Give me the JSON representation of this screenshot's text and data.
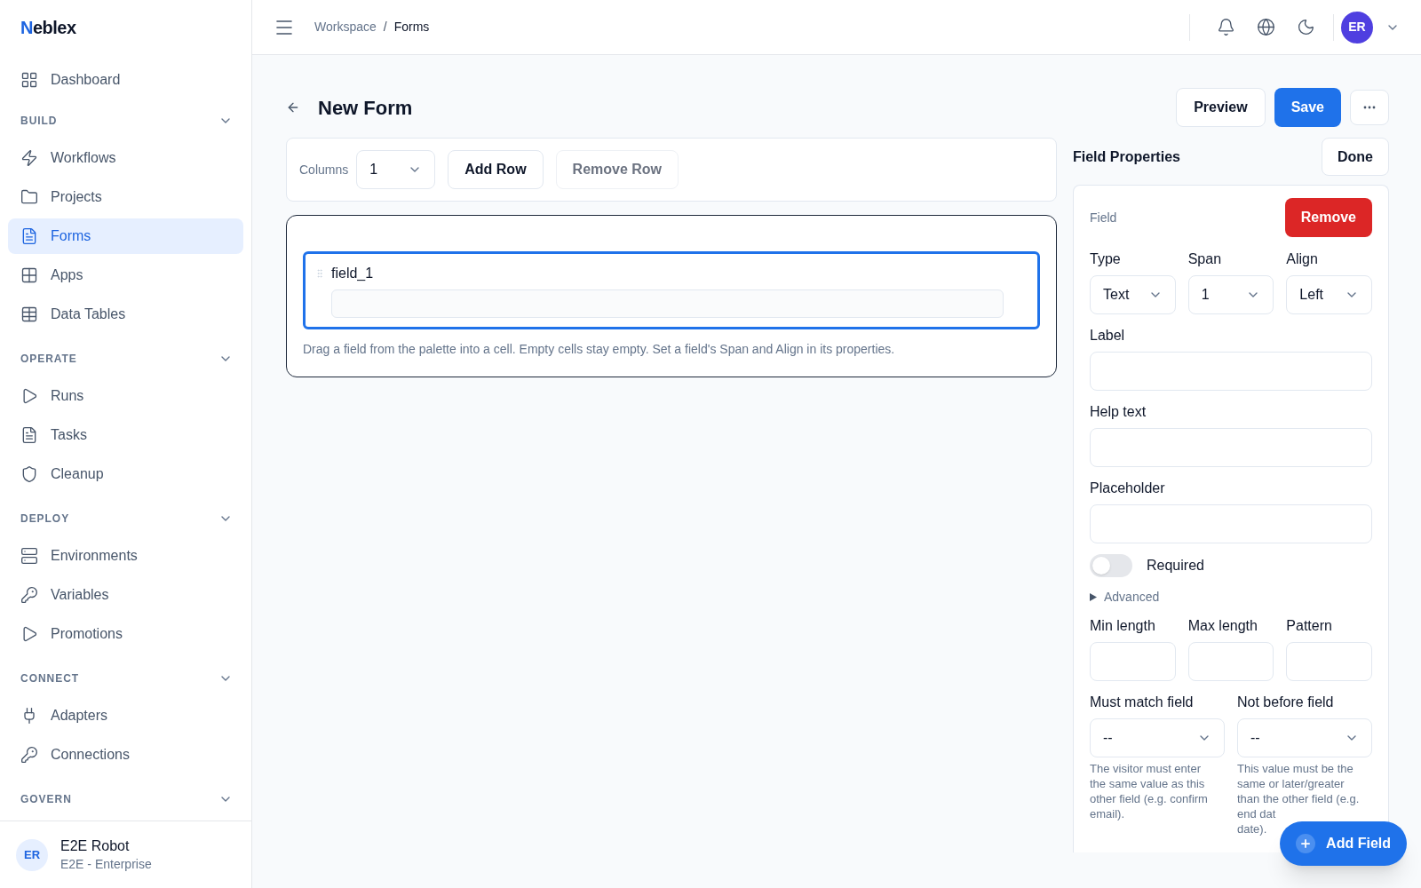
{
  "brand": {
    "name": "Neblex"
  },
  "sidebar": {
    "top_item": {
      "label": "Dashboard",
      "selected": false
    },
    "sections": [
      {
        "title": "BUILD",
        "expanded": true,
        "items": [
          {
            "label": "Workflows",
            "selected": false
          },
          {
            "label": "Projects",
            "selected": false
          },
          {
            "label": "Forms",
            "selected": true
          },
          {
            "label": "Apps",
            "selected": false
          },
          {
            "label": "Data Tables",
            "selected": false
          }
        ]
      },
      {
        "title": "OPERATE",
        "expanded": true,
        "items": [
          {
            "label": "Runs",
            "selected": false
          },
          {
            "label": "Tasks",
            "selected": false
          },
          {
            "label": "Cleanup",
            "selected": false
          }
        ]
      },
      {
        "title": "DEPLOY",
        "expanded": true,
        "items": [
          {
            "label": "Environments",
            "selected": false
          },
          {
            "label": "Variables",
            "selected": false
          },
          {
            "label": "Promotions",
            "selected": false
          }
        ]
      },
      {
        "title": "CONNECT",
        "expanded": true,
        "items": [
          {
            "label": "Adapters",
            "selected": false
          },
          {
            "label": "Connections",
            "selected": false
          }
        ]
      },
      {
        "title": "GOVERN",
        "expanded": true
      }
    ],
    "user": {
      "initials": "ER",
      "name": "E2E Robot",
      "org": "E2E - Enterprise"
    }
  },
  "header": {
    "breadcrumb": [
      "Workspace",
      "Forms"
    ],
    "breadcrumb_separator": "/",
    "avatar": "ER"
  },
  "page": {
    "title": "New Form",
    "actions": [
      {
        "label": "Preview",
        "kind": "secondary"
      },
      {
        "label": "Save",
        "kind": "primary"
      }
    ]
  },
  "toolbar": {
    "columns_label": "Columns",
    "columns_value": "1",
    "buttons": [
      {
        "label": "Add Row",
        "disabled": false
      },
      {
        "label": "Remove Row",
        "disabled": true
      }
    ]
  },
  "canvas": {
    "field": {
      "name": "field_1",
      "selected": true
    },
    "hint": "Drag a field from the palette into a cell. Empty cells stay empty. Set a field's Span and Align in its properties."
  },
  "properties": {
    "title": "Field Properties",
    "done": "Done",
    "section_label": "Field",
    "remove": "Remove",
    "selects": [
      {
        "label": "Type",
        "value": "Text"
      },
      {
        "label": "Span",
        "value": "1"
      },
      {
        "label": "Align",
        "value": "Left"
      }
    ],
    "text_fields": [
      {
        "label": "Label"
      },
      {
        "label": "Help text"
      },
      {
        "label": "Placeholder"
      }
    ],
    "required": {
      "label": "Required",
      "on": false
    },
    "advanced": {
      "label": "Advanced",
      "expanded": false
    },
    "constraints": [
      {
        "label": "Min length"
      },
      {
        "label": "Max length"
      },
      {
        "label": "Pattern"
      }
    ],
    "match_selects": [
      {
        "label": "Must match field",
        "value": "--",
        "help_lines": [
          "The visitor must enter",
          "the same value as this",
          "other field (e.g. confirm",
          "email)."
        ]
      },
      {
        "label": "Not before field",
        "value": "--",
        "help_lines": [
          "This value must be the",
          "same or later/greater",
          "than the other field (e.g.",
          "end dat",
          "date)."
        ]
      }
    ]
  },
  "fab": {
    "label": "Add Field"
  }
}
